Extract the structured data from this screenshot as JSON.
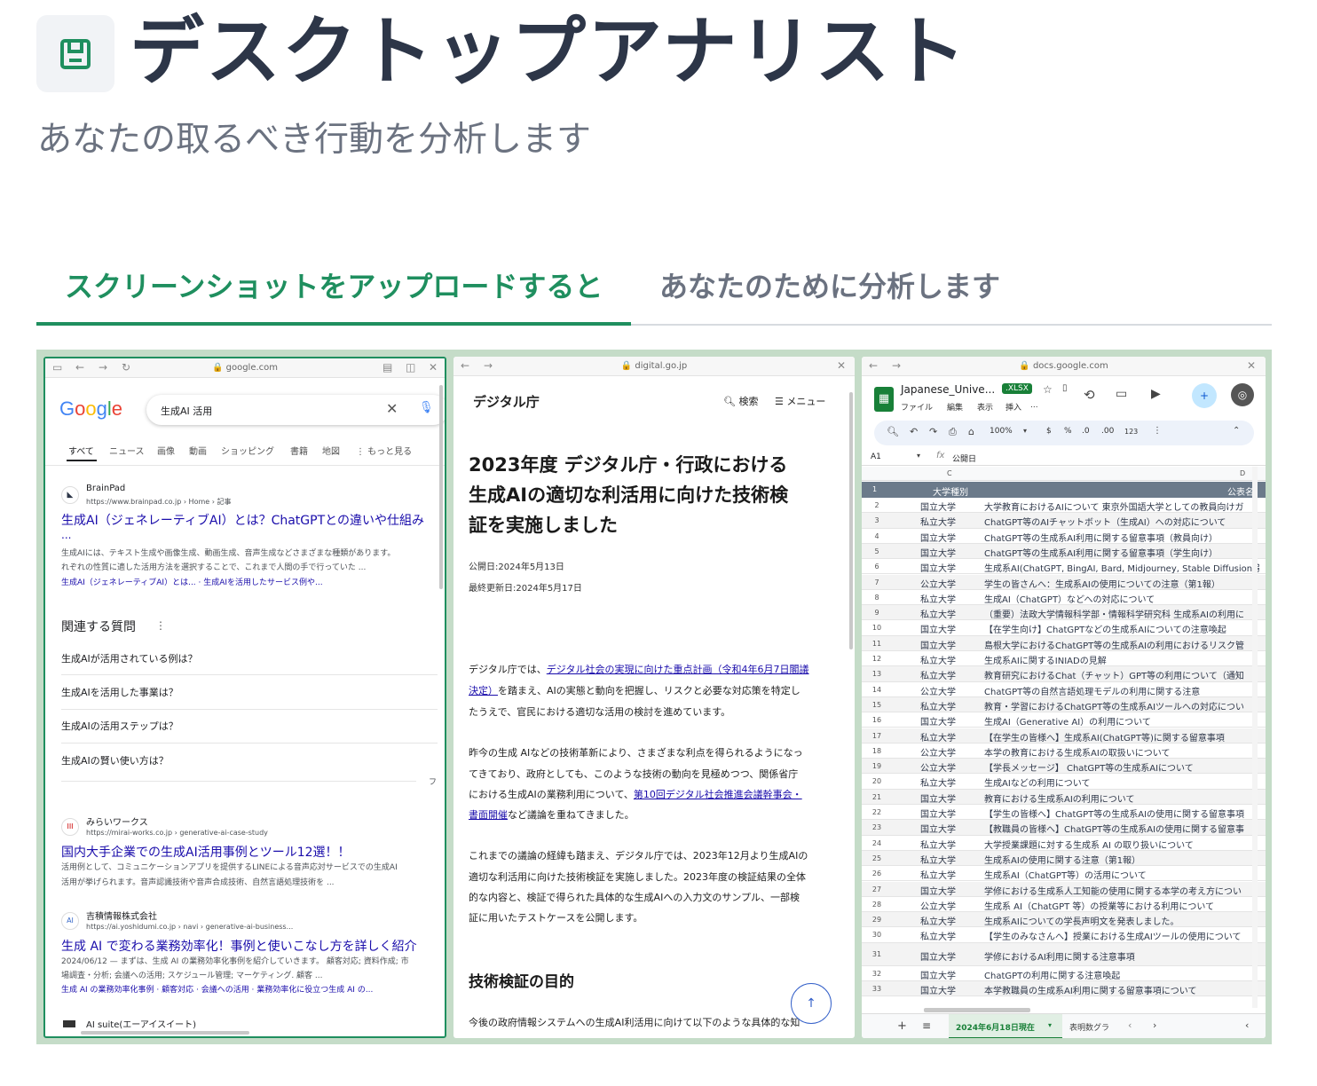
{
  "header": {
    "title": "デスクトップアナリスト",
    "subtitle": "あなたの取るべき行動を分析します"
  },
  "tabs": [
    {
      "label": "スクリーンショットをアップロードすると",
      "active": true
    },
    {
      "label": "あなたのために分析します",
      "active": false
    }
  ],
  "colors": {
    "accent": "#1f8f5f",
    "title": "#2d3648",
    "muted": "#6b7280"
  },
  "google_panel": {
    "url": "google.com",
    "logo": "Google",
    "query": "生成AI 活用",
    "tabs": [
      "すべて",
      "ニュース",
      "画像",
      "動画",
      "ショッピング",
      "書籍",
      "地図",
      "⋮ もっと見る"
    ],
    "result1": {
      "site": "BrainPad",
      "path": "https://www.brainpad.co.jp › Home › 記事",
      "title": "生成AI（ジェネレーティブAI）とは？ChatGPTとの違いや仕組み",
      "title_more": "...",
      "snippet1": "生成AIには、テキスト生成や画像生成、動画生成、音声生成などさまざまな種類があります。",
      "snippet2": "れぞれの性質に適した活用方法を選択することで、これまで人間の手で行っていた ...",
      "sublinks": "生成AI（ジェネレーティブAI）とは... · 生成AIを活用したサービス例や..."
    },
    "related_heading": "関連する質問",
    "related": [
      "生成AIが活用されている例は？",
      "生成AIを活用した事業は？",
      "生成AIの活用ステップは？",
      "生成AIの賢い使い方は？"
    ],
    "feedback": "フ",
    "result2": {
      "site": "みらいワークス",
      "path": "https://mirai-works.co.jp › generative-ai-case-study",
      "title": "国内大手企業での生成AI活用事例とツール12選！！",
      "snippet1": "活用例として、コミュニケーションアプリを提供するLINEによる音声応対サービスでの生成AI",
      "snippet2": "活用が挙げられます。音声認識技術や音声合成技術、自然言語処理技術を ..."
    },
    "result3": {
      "site": "吉積情報株式会社",
      "path": "https://ai.yoshidumi.co.jp › navi › generative-ai-business...",
      "title": "生成 AI で変わる業務効率化！事例と使いこなし方を詳しく紹介",
      "snippet1": "2024/06/12 — まずは、生成 AI の業務効率化事例を紹介していきます。 顧客対応; 資料作成; 市",
      "snippet2": "場調査・分析; 会議への活用; スケジュール管理; マーケティング. 顧客 ...",
      "sublinks": "生成 AI の業務効率化事例 · 顧客対応 · 会議への活用 · 業務効率化に役立つ生成 AI の..."
    },
    "result4_site": "AI suite(エーアイスイート)"
  },
  "digital_panel": {
    "url": "digital.go.jp",
    "logo": "デジタル庁",
    "search": "検索",
    "menu": "メニュー",
    "title_l1": "2023年度 デジタル庁・行政における",
    "title_l2": "生成AIの適切な利活用に向けた技術検",
    "title_l3": "証を実施しました",
    "published": "公開日:2024年5月13日",
    "updated": "最終更新日:2024年5月17日",
    "p1_a": "デジタル庁では、",
    "p1_link1": "デジタル社会の実現に向けた重点計画（令和4年6月7日閣議",
    "p1_link2": "決定）",
    "p1_b": "を踏まえ、AIの実態と動向を把握し、リスクと必要な対応策を特定し",
    "p1_c": "たうえで、官民における適切な活用の検討を進めています。",
    "p2_a": "昨今の生成 AIなどの技術革新により、さまざまな利点を得られるようになっ",
    "p2_b": "てきており、政府としても、このような技術の動向を見極めつつ、関係省庁",
    "p2_c": "における生成AIの業務利用について、",
    "p2_link1": "第10回デジタル社会推進会議幹事会・",
    "p2_link2": "書面開催",
    "p2_d": "など議論を重ねてきました。",
    "p3_a": "これまでの議論の経緯も踏まえ、デジタル庁では、2023年12月より生成AIの",
    "p3_b": "適切な利活用に向けた技術検証を実施しました。2023年度の検証結果の全体",
    "p3_c": "的な内容と、検証で得られた具体的な生成AIへの入力文のサンプル、一部検",
    "p3_d": "証に用いたテストケースを公開します。",
    "section": "技術検証の目的",
    "last": "今後の政府情報システムへの生成AI利活用に向けて以下のような具体的な知"
  },
  "sheets_panel": {
    "url": "docs.google.com",
    "file_name": "Japanese_Unive...",
    "badge": ".XLSX",
    "menus": [
      "ファイル",
      "編集",
      "表示",
      "挿入",
      "..."
    ],
    "zoom": "100%",
    "toolbar_items": [
      "$",
      "%",
      ".0",
      ".00",
      "123"
    ],
    "cell_ref": "A1",
    "formula": "公開日",
    "col_c": "C",
    "col_d": "D",
    "header_c": "大学種別",
    "header_d": "公表名",
    "rows": [
      {
        "n": "2",
        "c": "国立大学",
        "d": "大学教育におけるAIについて 東京外国語大学としての教員向けガ"
      },
      {
        "n": "3",
        "c": "私立大学",
        "d": "ChatGPT等のAIチャットボット（生成AI）への対応について"
      },
      {
        "n": "4",
        "c": "国立大学",
        "d": "ChatGPT等の生成系AI利用に関する留意事項（教員向け）"
      },
      {
        "n": "5",
        "c": "国立大学",
        "d": "ChatGPT等の生成系AI利用に関する留意事項（学生向け）"
      },
      {
        "n": "6",
        "c": "国立大学",
        "d": "生成系AI(ChatGPT, BingAI, Bard, Midjourney, Stable Diffusion等)"
      },
      {
        "n": "7",
        "c": "公立大学",
        "d": "学生の皆さんへ：生成系AIの使用についての注意（第1報）"
      },
      {
        "n": "8",
        "c": "私立大学",
        "d": "生成AI（ChatGPT）などへの対応について"
      },
      {
        "n": "9",
        "c": "私立大学",
        "d": "（重要）法政大学情報科学部・情報科学研究科 生成系AIの利用に"
      },
      {
        "n": "10",
        "c": "国立大学",
        "d": "【在学生向け】ChatGPTなどの生成系AIについての注意喚起"
      },
      {
        "n": "11",
        "c": "国立大学",
        "d": "島根大学におけるChatGPT等の生成系AIの利用におけるリスク管"
      },
      {
        "n": "12",
        "c": "私立大学",
        "d": "生成系AIに関するINIADの見解"
      },
      {
        "n": "13",
        "c": "私立大学",
        "d": "教育研究におけるChat（チャット）GPT等の利用について（通知"
      },
      {
        "n": "14",
        "c": "公立大学",
        "d": "ChatGPT等の自然言語処理モデルの利用に関する注意"
      },
      {
        "n": "15",
        "c": "私立大学",
        "d": "教育・学習におけるChatGPT等の生成系AIツールへの対応につい"
      },
      {
        "n": "16",
        "c": "国立大学",
        "d": "生成AI（Generative AI）の利用について"
      },
      {
        "n": "17",
        "c": "私立大学",
        "d": "【在学生の皆様へ】生成系AI(ChatGPT等)に関する留意事項"
      },
      {
        "n": "18",
        "c": "公立大学",
        "d": "本学の教育における生成系AIの取扱いについて"
      },
      {
        "n": "19",
        "c": "公立大学",
        "d": "【学長メッセージ】 ChatGPT等の生成系AIについて"
      },
      {
        "n": "20",
        "c": "私立大学",
        "d": "生成AIなどの利用について"
      },
      {
        "n": "21",
        "c": "国立大学",
        "d": "教育における生成系AIの利用について"
      },
      {
        "n": "22",
        "c": "国立大学",
        "d": "【学生の皆様へ】ChatGPT等の生成系AIの使用に関する留意事項"
      },
      {
        "n": "23",
        "c": "国立大学",
        "d": "【教職員の皆様へ】ChatGPT等の生成系AIの使用に関する留意事"
      },
      {
        "n": "24",
        "c": "私立大学",
        "d": "大学授業課題に対する生成系 AI の取り扱いについて"
      },
      {
        "n": "25",
        "c": "私立大学",
        "d": "生成系AIの使用に関する注意（第1報）"
      },
      {
        "n": "26",
        "c": "私立大学",
        "d": "生成系AI（ChatGPT等）の活用について"
      },
      {
        "n": "27",
        "c": "国立大学",
        "d": "学修における生成系人工知能の使用に関する本学の考え方につい"
      },
      {
        "n": "28",
        "c": "公立大学",
        "d": "生成系 AI（ChatGPT 等）の授業等における利用について"
      },
      {
        "n": "29",
        "c": "私立大学",
        "d": "生成系AIについての学長声明文を発表しました。"
      },
      {
        "n": "30",
        "c": "私立大学",
        "d": "【学生のみなさんへ】授業における生成AIツールの使用について"
      },
      {
        "n": "31",
        "c": "国立大学",
        "d": "学修におけるAI利用に関する注意事項"
      },
      {
        "n": "32",
        "c": "国立大学",
        "d": "ChatGPTの利用に関する注意喚起"
      },
      {
        "n": "33",
        "c": "国立大学",
        "d": "本学教職員の生成系AI利用に関する留意事項について"
      }
    ],
    "sheet_tab_active": "2024年6月18日現在",
    "sheet_tab_other": "表明数グラ"
  }
}
